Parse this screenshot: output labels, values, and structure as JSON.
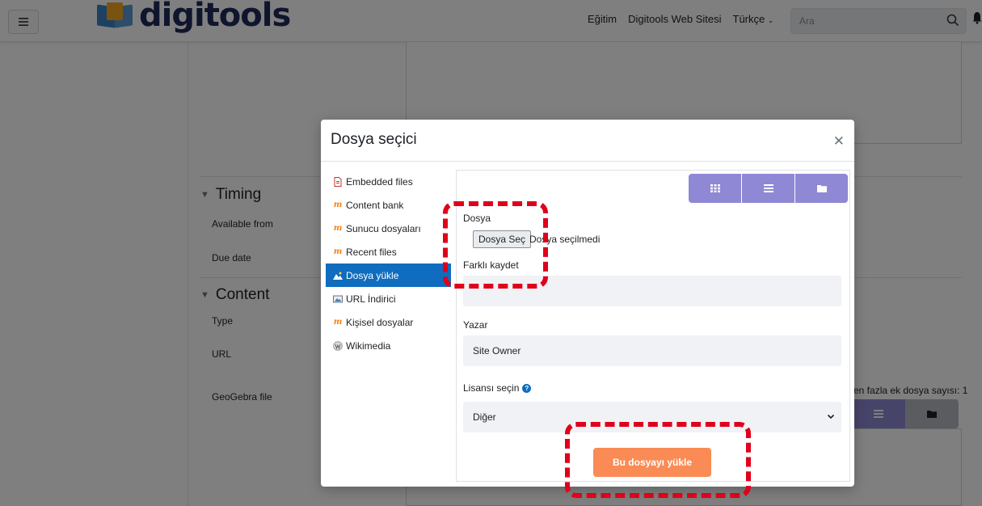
{
  "nav": {
    "menu_icon": "hamburger-icon",
    "logo_text": "digitools",
    "links": [
      "Eğitim",
      "Digitools Web Sitesi",
      "Türkçe"
    ],
    "search_placeholder": "Ara"
  },
  "page": {
    "section_timing": "Timing",
    "available_from": "Available from",
    "due_date": "Due date",
    "section_content": "Content",
    "type_label": "Type",
    "url_label": "URL",
    "geogebra_label": "GeoGebra file",
    "max_files_info": "en fazla ek dosya sayısı: 1"
  },
  "modal": {
    "title": "Dosya seçici",
    "repos": [
      {
        "label": "Embedded files",
        "icon": "file-icon"
      },
      {
        "label": "Content bank",
        "icon": "moodle-icon"
      },
      {
        "label": "Sunucu dosyaları",
        "icon": "moodle-icon"
      },
      {
        "label": "Recent files",
        "icon": "moodle-icon"
      },
      {
        "label": "Dosya yükle",
        "icon": "upload-icon",
        "active": true
      },
      {
        "label": "URL İndirici",
        "icon": "url-icon"
      },
      {
        "label": "Kişisel dosyalar",
        "icon": "moodle-icon"
      },
      {
        "label": "Wikimedia",
        "icon": "wikimedia-icon"
      }
    ],
    "form": {
      "file_label": "Dosya",
      "file_button": "Dosya Seç",
      "file_status": "Dosya seçilmedi",
      "save_as_label": "Farklı kaydet",
      "save_as_value": "",
      "author_label": "Yazar",
      "author_value": "Site Owner",
      "license_label": "Lisansı seçin",
      "license_value": "Diğer",
      "upload_button": "Bu dosyayı yükle"
    }
  },
  "colors": {
    "primary": "#0f6cbf",
    "view_button": "#8f88d4",
    "upload_button": "#fa8b55",
    "highlight": "#e0001b"
  }
}
